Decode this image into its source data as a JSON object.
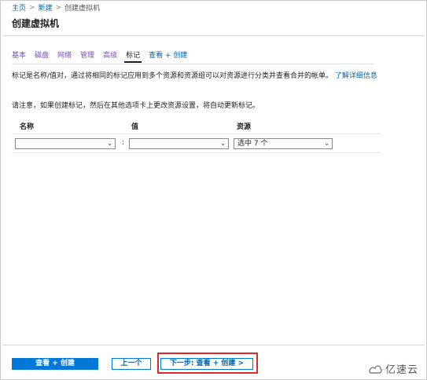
{
  "breadcrumb": {
    "home": "主页",
    "sep": ">",
    "new": "新建",
    "current": "创建虚拟机"
  },
  "page_title": "创建虚拟机",
  "tabs": [
    {
      "label": "基本",
      "state": "visited"
    },
    {
      "label": "磁盘",
      "state": "visited"
    },
    {
      "label": "网络",
      "state": "visited"
    },
    {
      "label": "管理",
      "state": "visited"
    },
    {
      "label": "高级",
      "state": "visited"
    },
    {
      "label": "标记",
      "state": "active"
    },
    {
      "label": "查看 + 创建",
      "state": "link"
    }
  ],
  "description": {
    "text": "标记是名称/值对，通过将相同的标记应用到多个资源和资源组可以对资源进行分类并查看合并的帐单。",
    "learn_more": "了解详细信息"
  },
  "note": "请注意，如果创建标记，然后在其他选项卡上更改资源设置，将自动更新标记。",
  "table": {
    "headers": {
      "name": "名称",
      "value": "值",
      "resource": "资源"
    },
    "row": {
      "name_value": "",
      "separator": ":",
      "value_value": "",
      "resource_value": "选中 7 个"
    }
  },
  "footer": {
    "review_create": "查看 + 创建",
    "previous": "上一个",
    "next": "下一步: 查看 + 创建 >"
  },
  "watermark": {
    "text": "亿速云"
  },
  "colors": {
    "accent": "#0078d7",
    "link": "#0063b1",
    "visited": "#7a4fb3",
    "highlight": "#e0272a"
  }
}
